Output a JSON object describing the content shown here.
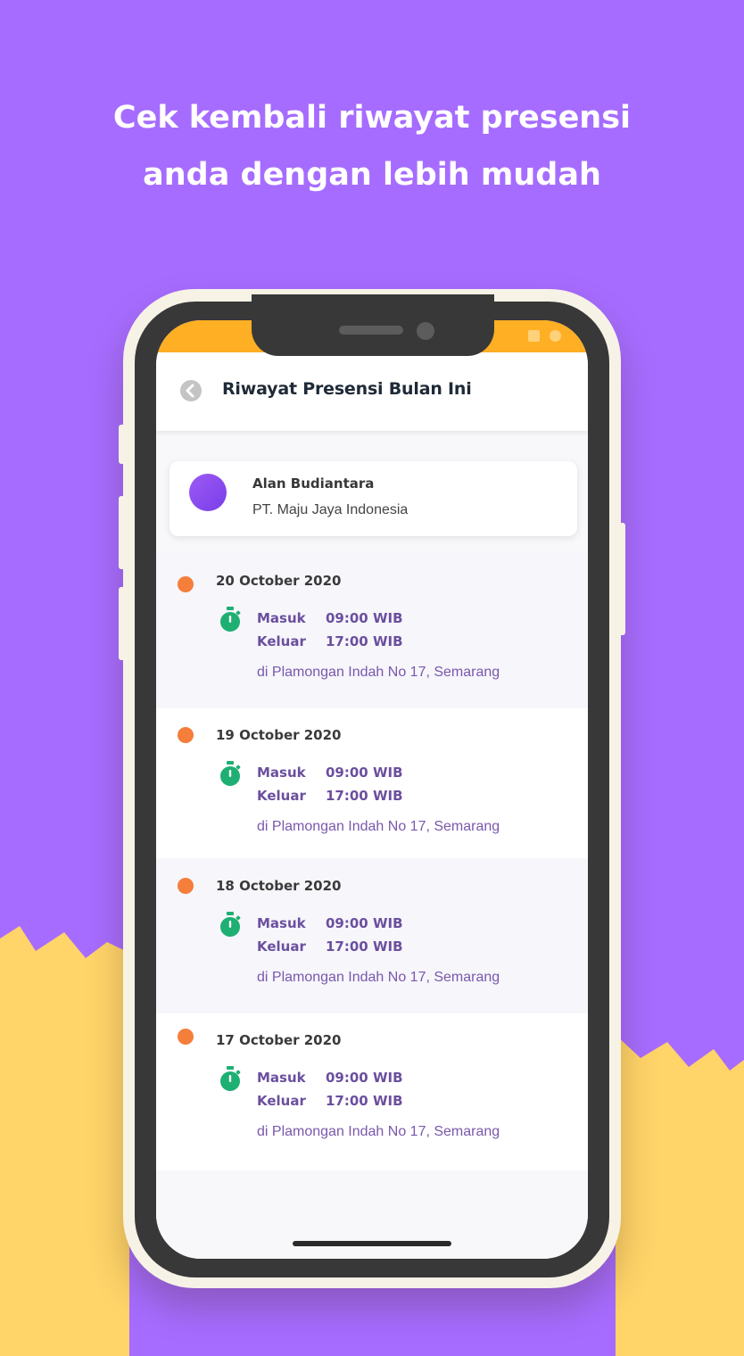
{
  "headline": {
    "line1": "Cek kembali riwayat presensi",
    "line2": "anda dengan lebih mudah"
  },
  "colors": {
    "background": "#A66CFF",
    "ground": "#FFD469",
    "status_bar": "#FFAF24",
    "timeline": "#F57E3B",
    "stopwatch": "#1FAF73",
    "accent_text": "#6B4F9E"
  },
  "app": {
    "back_icon": "chevron-left-icon",
    "title": "Riwayat Presensi Bulan Ini",
    "profile": {
      "name": "Alan Budiantara",
      "company": "PT. Maju Jaya Indonesia"
    },
    "history": [
      {
        "date": "20 October 2020",
        "in_label": "Masuk",
        "in_time": "09:00 WIB",
        "out_label": "Keluar",
        "out_time": "17:00 WIB",
        "location": "di Plamongan Indah No 17, Semarang"
      },
      {
        "date": "19 October 2020",
        "in_label": "Masuk",
        "in_time": "09:00 WIB",
        "out_label": "Keluar",
        "out_time": "17:00 WIB",
        "location": "di Plamongan Indah No 17, Semarang"
      },
      {
        "date": "18 October 2020",
        "in_label": "Masuk",
        "in_time": "09:00 WIB",
        "out_label": "Keluar",
        "out_time": "17:00 WIB",
        "location": "di Plamongan Indah No 17, Semarang"
      },
      {
        "date": "17 October 2020",
        "in_label": "Masuk",
        "in_time": "09:00 WIB",
        "out_label": "Keluar",
        "out_time": "17:00 WIB",
        "location": "di Plamongan Indah No 17, Semarang"
      }
    ]
  }
}
